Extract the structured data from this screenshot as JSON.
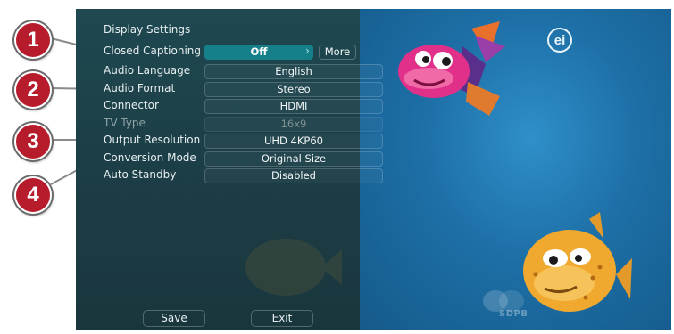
{
  "callouts": [
    "1",
    "2",
    "3",
    "4"
  ],
  "menu": {
    "title": "Display Settings",
    "rows": [
      {
        "label": "Closed Captioning",
        "value": "Off",
        "state": "active"
      },
      {
        "label": "Audio Language",
        "value": "English",
        "state": "normal"
      },
      {
        "label": "Audio Format",
        "value": "Stereo",
        "state": "normal"
      },
      {
        "label": "Connector",
        "value": "HDMI",
        "state": "normal"
      },
      {
        "label": "TV Type",
        "value": "16x9",
        "state": "disabled"
      },
      {
        "label": "Output Resolution",
        "value": "UHD 4KP60",
        "state": "normal"
      },
      {
        "label": "Conversion Mode",
        "value": "Original Size",
        "state": "normal"
      },
      {
        "label": "Auto Standby",
        "value": "Disabled",
        "state": "normal"
      }
    ],
    "more_label": "More",
    "chevron_icon": "chevron-right-icon",
    "buttons": {
      "save": "Save",
      "exit": "Exit"
    }
  },
  "video": {
    "logo_text": "ei",
    "watermark_text": "SDPB"
  },
  "colors": {
    "callout": "#b71c2c",
    "menu_bg": "#1f4850",
    "active_value": "#16808a",
    "video_bg": "#2f8fc9"
  }
}
